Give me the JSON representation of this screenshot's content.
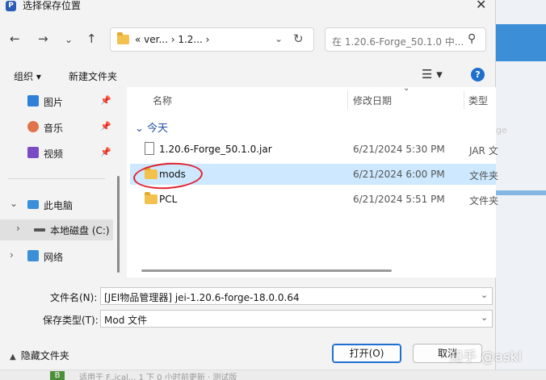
{
  "window": {
    "title": "选择保存位置",
    "app_icon_letter": "P"
  },
  "address_bar": {
    "crumbs": "«  ver...  ›  1.2...  ›"
  },
  "search": {
    "placeholder": "在 1.20.6-Forge_50.1.0 中..."
  },
  "toolbar": {
    "organize": "组织 ▾",
    "new_folder": "新建文件夹",
    "help": "?"
  },
  "nav_pane": {
    "items": [
      {
        "label": "图片",
        "pinned": true
      },
      {
        "label": "音乐",
        "pinned": true
      },
      {
        "label": "视频",
        "pinned": true
      },
      {
        "label": "此电脑"
      },
      {
        "label": "本地磁盘 (C:)"
      },
      {
        "label": "网络"
      }
    ]
  },
  "file_list": {
    "columns": {
      "name": "名称",
      "modified": "修改日期",
      "type": "类型"
    },
    "group": "今天",
    "rows": [
      {
        "name": "1.20.6-Forge_50.1.0.jar",
        "date": "6/21/2024 5:30 PM",
        "type": "JAR 文",
        "icon": "file-icon"
      },
      {
        "name": "mods",
        "date": "6/21/2024 6:00 PM",
        "type": "文件夹",
        "icon": "folder-icon",
        "selected": true
      },
      {
        "name": "PCL",
        "date": "6/21/2024 5:51 PM",
        "type": "文件夹",
        "icon": "folder-icon"
      }
    ]
  },
  "form": {
    "filename_label": "文件名(N):",
    "filename_value": "[JEI物品管理器] jei-1.20.6-forge-18.0.0.64",
    "filetype_label": "保存类型(T):",
    "filetype_value": "Mod 文件"
  },
  "footer": {
    "hide_folders": "隐藏文件夹",
    "open": "打开(O)",
    "cancel": "取消"
  },
  "background": {
    "ghost_text": "ge",
    "badge": "B",
    "line": "适用于 F..ical... 1 下 0 小时前更新 · 测试版"
  },
  "watermark": "知乎 @askl",
  "colors": {
    "accent": "#1f6fcf",
    "selection": "#cde8ff",
    "annotation": "#e0232e",
    "folder": "#f2c14e"
  }
}
